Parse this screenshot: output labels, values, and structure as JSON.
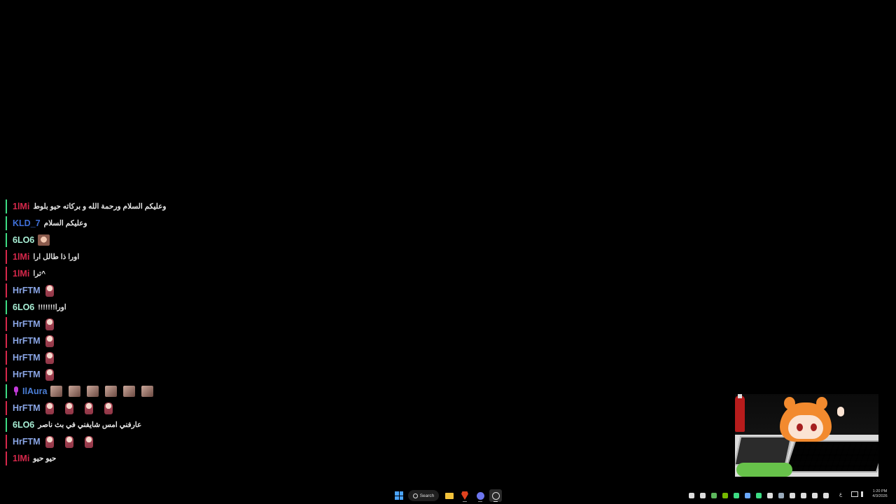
{
  "chat": {
    "messages": [
      {
        "user": "1lMi",
        "color": "#d6284b",
        "text": "وعليكم السلام ورحمة الله و بركاته حيو بلوط",
        "emotes": [],
        "badge": false
      },
      {
        "user": "KLD_7",
        "color": "#3f6fd8",
        "text": "وعليكم السلام",
        "emotes": [],
        "badge": false
      },
      {
        "user": "6LO6",
        "color": "#a9f0d6",
        "text": "",
        "emotes": [
          "face"
        ],
        "badge": false
      },
      {
        "user": "1lMi",
        "color": "#d6284b",
        "text": "اورا ذا طالل ارا",
        "emotes": [],
        "badge": false
      },
      {
        "user": "1lMi",
        "color": "#d6284b",
        "text": "^ترا",
        "emotes": [],
        "badge": false
      },
      {
        "user": "HrFTM",
        "color": "#8aa6e6",
        "text": "",
        "emotes": [
          "girl"
        ],
        "badge": false
      },
      {
        "user": "6LO6",
        "color": "#a9f0d6",
        "text": "اورا!!!!!!!",
        "emotes": [],
        "badge": false
      },
      {
        "user": "HrFTM",
        "color": "#8aa6e6",
        "text": "",
        "emotes": [
          "girl"
        ],
        "badge": false
      },
      {
        "user": "HrFTM",
        "color": "#8aa6e6",
        "text": "",
        "emotes": [
          "girl"
        ],
        "badge": false
      },
      {
        "user": "HrFTM",
        "color": "#8aa6e6",
        "text": "",
        "emotes": [
          "girl"
        ],
        "badge": false
      },
      {
        "user": "HrFTM",
        "color": "#8aa6e6",
        "text": "",
        "emotes": [
          "girl"
        ],
        "badge": false
      },
      {
        "user": "IlAura",
        "color": "#4b7ed6",
        "text": "",
        "emotes": [
          "cat",
          "cat",
          "cat",
          "cat",
          "cat",
          "cat"
        ],
        "badge": true
      },
      {
        "user": "HrFTM",
        "color": "#8aa6e6",
        "text": "",
        "emotes": [
          "girl",
          "girl",
          "girl",
          "girl"
        ],
        "badge": false
      },
      {
        "user": "6LO6",
        "color": "#a9f0d6",
        "text": "عارفني امس شايفني في بث ناصر",
        "emotes": [],
        "badge": false
      },
      {
        "user": "HrFTM",
        "color": "#8aa6e6",
        "text": "",
        "emotes": [
          "girl",
          "girl",
          "girl"
        ],
        "badge": false
      },
      {
        "user": "1lMi",
        "color": "#d6284b",
        "text": "حيو حيو",
        "emotes": [],
        "badge": false
      }
    ],
    "bar_colors": [
      "#3ddc84",
      "#3ddc84",
      "#3ddc84",
      "#d6284b",
      "#d6284b",
      "#d6284b",
      "#3ddc84",
      "#d6284b",
      "#d6284b",
      "#d6284b",
      "#d6284b",
      "#3ddc84",
      "#d6284b",
      "#3ddc84",
      "#d6284b",
      "#d6284b"
    ]
  },
  "taskbar": {
    "search_label": "Search",
    "start_icon": "windows-logo-icon",
    "apps": [
      "file-explorer-icon",
      "brave-browser-icon",
      "discord-icon",
      "obs-icon"
    ],
    "tray_icons": [
      "onedrive-icon",
      "steam-icon",
      "app-icon",
      "nvidia-icon",
      "circle-icon",
      "shield-icon",
      "xbox-icon",
      "bluetooth-icon",
      "pen-icon",
      "b-icon",
      "monitor-icon",
      "battery-icon",
      "mic-icon"
    ],
    "lang": "ع",
    "time": "1:20 PM",
    "date": "4/3/2026"
  }
}
